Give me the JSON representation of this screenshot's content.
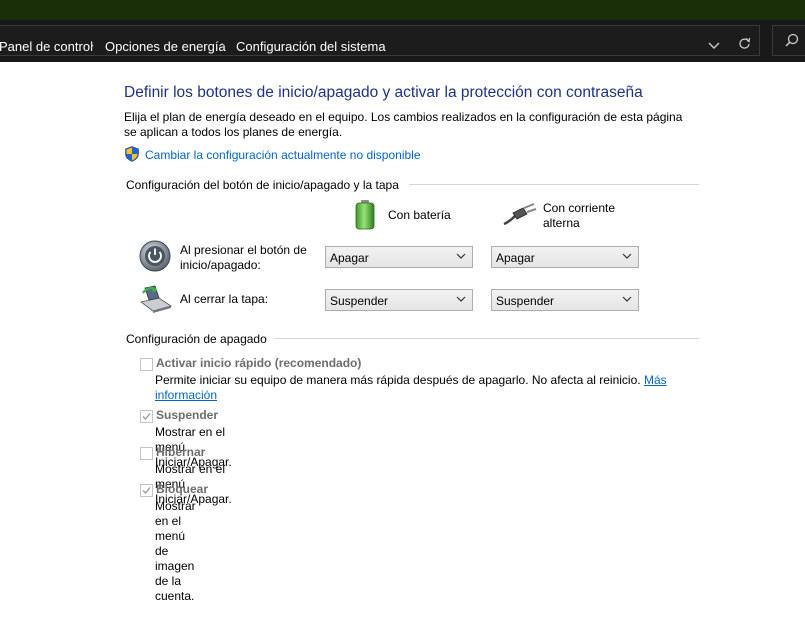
{
  "breadcrumb": {
    "items": [
      "Panel de control",
      "Opciones de energía",
      "Configuración del sistema"
    ],
    "separator": "›"
  },
  "address_buttons": {
    "dropdown_icon": "chevron-down-icon",
    "refresh_icon": "refresh-icon",
    "search_icon": "search-icon"
  },
  "page": {
    "title": "Definir los botones de inicio/apagado y activar la protección con contraseña",
    "description": "Elija el plan de energía deseado en el equipo. Los cambios realizados en la configuración de esta página se aplican a todos los planes de energía.",
    "admin_link": "Cambiar la configuración actualmente no disponible"
  },
  "power_buttons_section": {
    "heading": "Configuración del botón de inicio/apagado y la tapa",
    "col_battery": "Con batería",
    "col_ac_line1": "Con corriente",
    "col_ac_line2": "alterna",
    "rows": [
      {
        "label_line1": "Al presionar el botón de",
        "label_line2": "inicio/apagado:",
        "battery": "Apagar",
        "ac": "Apagar"
      },
      {
        "label_line1": "Al cerrar la tapa:",
        "label_line2": "",
        "battery": "Suspender",
        "ac": "Suspender"
      }
    ]
  },
  "shutdown_section": {
    "heading": "Configuración de apagado",
    "items": [
      {
        "label": "Activar inicio rápido (recomendado)",
        "checked": false,
        "desc_line1": "Permite iniciar su equipo de manera más rápida después de apagarlo. No afecta al reinicio.",
        "link_part1": "Más",
        "link_part2": "información"
      },
      {
        "label": "Suspender",
        "checked": true,
        "desc": "Mostrar en el menú Iniciar/Apagar."
      },
      {
        "label": "Hibernar",
        "checked": false,
        "desc": "Mostrar en el menú Iniciar/Apagar."
      },
      {
        "label": "Bloquear",
        "checked": true,
        "desc": "Mostrar en el menú de imagen de la cuenta."
      }
    ]
  },
  "colors": {
    "title": "#1e3287",
    "link": "#0066cc",
    "disabled_label": "#6d6d6d",
    "titlebar": "#1a2e08",
    "addressbar": "#191919"
  }
}
